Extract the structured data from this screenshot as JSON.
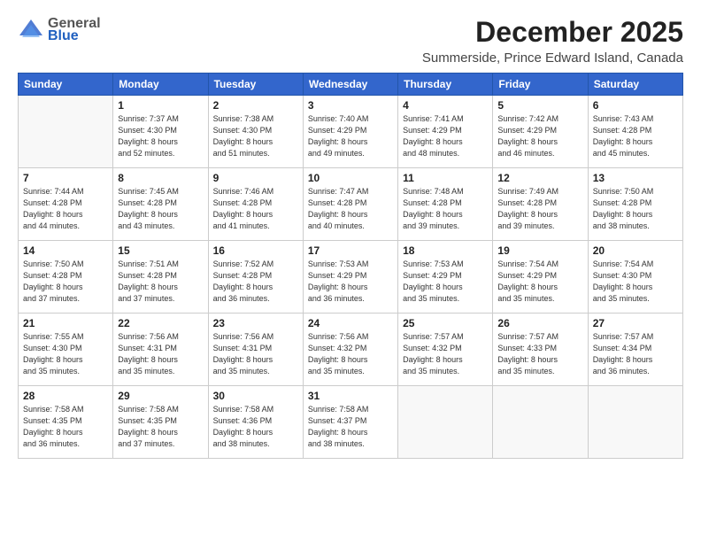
{
  "header": {
    "logo_general": "General",
    "logo_blue": "Blue",
    "month": "December 2025",
    "location": "Summerside, Prince Edward Island, Canada"
  },
  "weekdays": [
    "Sunday",
    "Monday",
    "Tuesday",
    "Wednesday",
    "Thursday",
    "Friday",
    "Saturday"
  ],
  "weeks": [
    [
      {
        "day": "",
        "info": ""
      },
      {
        "day": "1",
        "info": "Sunrise: 7:37 AM\nSunset: 4:30 PM\nDaylight: 8 hours\nand 52 minutes."
      },
      {
        "day": "2",
        "info": "Sunrise: 7:38 AM\nSunset: 4:30 PM\nDaylight: 8 hours\nand 51 minutes."
      },
      {
        "day": "3",
        "info": "Sunrise: 7:40 AM\nSunset: 4:29 PM\nDaylight: 8 hours\nand 49 minutes."
      },
      {
        "day": "4",
        "info": "Sunrise: 7:41 AM\nSunset: 4:29 PM\nDaylight: 8 hours\nand 48 minutes."
      },
      {
        "day": "5",
        "info": "Sunrise: 7:42 AM\nSunset: 4:29 PM\nDaylight: 8 hours\nand 46 minutes."
      },
      {
        "day": "6",
        "info": "Sunrise: 7:43 AM\nSunset: 4:28 PM\nDaylight: 8 hours\nand 45 minutes."
      }
    ],
    [
      {
        "day": "7",
        "info": "Sunrise: 7:44 AM\nSunset: 4:28 PM\nDaylight: 8 hours\nand 44 minutes."
      },
      {
        "day": "8",
        "info": "Sunrise: 7:45 AM\nSunset: 4:28 PM\nDaylight: 8 hours\nand 43 minutes."
      },
      {
        "day": "9",
        "info": "Sunrise: 7:46 AM\nSunset: 4:28 PM\nDaylight: 8 hours\nand 41 minutes."
      },
      {
        "day": "10",
        "info": "Sunrise: 7:47 AM\nSunset: 4:28 PM\nDaylight: 8 hours\nand 40 minutes."
      },
      {
        "day": "11",
        "info": "Sunrise: 7:48 AM\nSunset: 4:28 PM\nDaylight: 8 hours\nand 39 minutes."
      },
      {
        "day": "12",
        "info": "Sunrise: 7:49 AM\nSunset: 4:28 PM\nDaylight: 8 hours\nand 39 minutes."
      },
      {
        "day": "13",
        "info": "Sunrise: 7:50 AM\nSunset: 4:28 PM\nDaylight: 8 hours\nand 38 minutes."
      }
    ],
    [
      {
        "day": "14",
        "info": "Sunrise: 7:50 AM\nSunset: 4:28 PM\nDaylight: 8 hours\nand 37 minutes."
      },
      {
        "day": "15",
        "info": "Sunrise: 7:51 AM\nSunset: 4:28 PM\nDaylight: 8 hours\nand 37 minutes."
      },
      {
        "day": "16",
        "info": "Sunrise: 7:52 AM\nSunset: 4:28 PM\nDaylight: 8 hours\nand 36 minutes."
      },
      {
        "day": "17",
        "info": "Sunrise: 7:53 AM\nSunset: 4:29 PM\nDaylight: 8 hours\nand 36 minutes."
      },
      {
        "day": "18",
        "info": "Sunrise: 7:53 AM\nSunset: 4:29 PM\nDaylight: 8 hours\nand 35 minutes."
      },
      {
        "day": "19",
        "info": "Sunrise: 7:54 AM\nSunset: 4:29 PM\nDaylight: 8 hours\nand 35 minutes."
      },
      {
        "day": "20",
        "info": "Sunrise: 7:54 AM\nSunset: 4:30 PM\nDaylight: 8 hours\nand 35 minutes."
      }
    ],
    [
      {
        "day": "21",
        "info": "Sunrise: 7:55 AM\nSunset: 4:30 PM\nDaylight: 8 hours\nand 35 minutes."
      },
      {
        "day": "22",
        "info": "Sunrise: 7:56 AM\nSunset: 4:31 PM\nDaylight: 8 hours\nand 35 minutes."
      },
      {
        "day": "23",
        "info": "Sunrise: 7:56 AM\nSunset: 4:31 PM\nDaylight: 8 hours\nand 35 minutes."
      },
      {
        "day": "24",
        "info": "Sunrise: 7:56 AM\nSunset: 4:32 PM\nDaylight: 8 hours\nand 35 minutes."
      },
      {
        "day": "25",
        "info": "Sunrise: 7:57 AM\nSunset: 4:32 PM\nDaylight: 8 hours\nand 35 minutes."
      },
      {
        "day": "26",
        "info": "Sunrise: 7:57 AM\nSunset: 4:33 PM\nDaylight: 8 hours\nand 35 minutes."
      },
      {
        "day": "27",
        "info": "Sunrise: 7:57 AM\nSunset: 4:34 PM\nDaylight: 8 hours\nand 36 minutes."
      }
    ],
    [
      {
        "day": "28",
        "info": "Sunrise: 7:58 AM\nSunset: 4:35 PM\nDaylight: 8 hours\nand 36 minutes."
      },
      {
        "day": "29",
        "info": "Sunrise: 7:58 AM\nSunset: 4:35 PM\nDaylight: 8 hours\nand 37 minutes."
      },
      {
        "day": "30",
        "info": "Sunrise: 7:58 AM\nSunset: 4:36 PM\nDaylight: 8 hours\nand 38 minutes."
      },
      {
        "day": "31",
        "info": "Sunrise: 7:58 AM\nSunset: 4:37 PM\nDaylight: 8 hours\nand 38 minutes."
      },
      {
        "day": "",
        "info": ""
      },
      {
        "day": "",
        "info": ""
      },
      {
        "day": "",
        "info": ""
      }
    ]
  ]
}
